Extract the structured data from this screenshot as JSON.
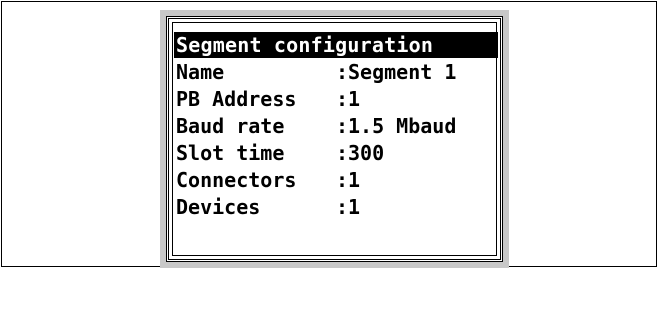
{
  "panel": {
    "title": "Segment configuration",
    "rows": [
      {
        "label": "Name",
        "value": "Segment 1"
      },
      {
        "label": "PB Address",
        "value": "1"
      },
      {
        "label": "Baud rate",
        "value": "1.5 Mbaud"
      },
      {
        "label": "Slot time",
        "value": "300"
      },
      {
        "label": "Connectors",
        "value": "1"
      },
      {
        "label": "Devices",
        "value": "1"
      }
    ],
    "separator": ":"
  },
  "colors": {
    "bezel": "#c8c8c8",
    "title_background": "#000000",
    "title_text": "#ffffff",
    "text": "#000000"
  }
}
